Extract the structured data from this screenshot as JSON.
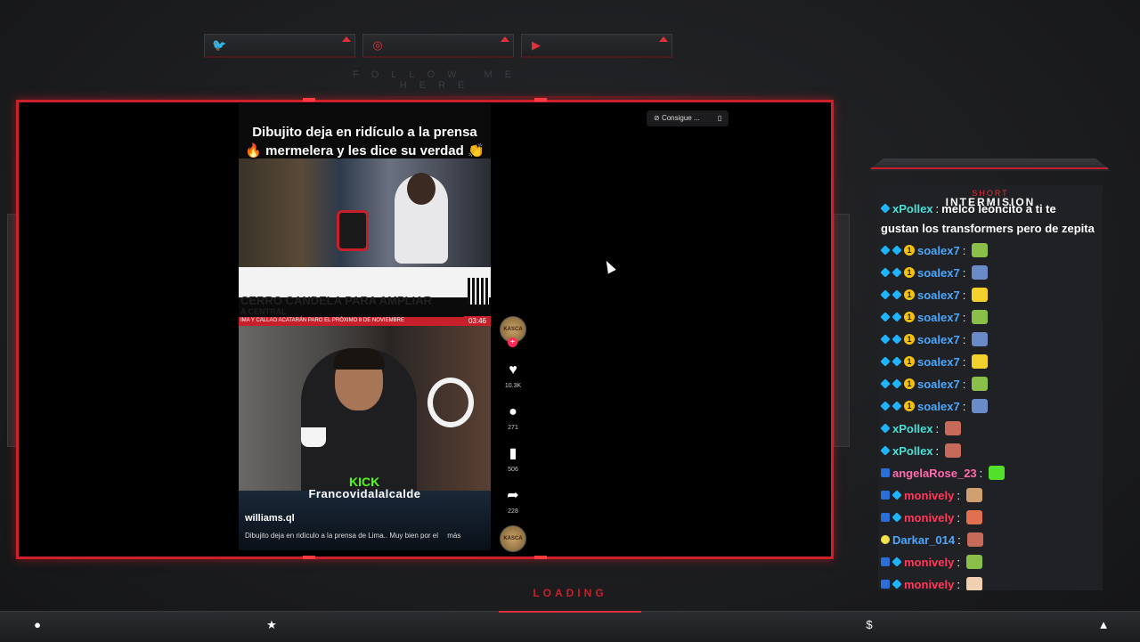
{
  "overlay": {
    "follow_text": "FOLLOW ME HERE",
    "loading_text": "LOADING",
    "chat_header_small": "SHORT",
    "chat_header_big": "INTERMISION"
  },
  "social": [
    {
      "icon": "twitter-icon",
      "glyph": "🐦"
    },
    {
      "icon": "instagram-icon",
      "glyph": "◎"
    },
    {
      "icon": "youtube-icon",
      "glyph": "▶"
    }
  ],
  "video": {
    "title_line1": "Dibujito deja en ridículo a la prensa",
    "title_line2": "🔥 mermelera y les dice su verdad 👏",
    "news_headline": "CERRO CANDELA PARA AMPLIAR",
    "news_sub": "A CENTRAL",
    "news_ticker": "IMA Y CALLAO ACATARÁN PARO EL PRÓXIMO 8 DE NOVIEMBRE",
    "news_time": "03:46",
    "kick_text": "KICK",
    "streamer_name": "Francovidalalcalde",
    "username": "williams.ql",
    "caption": "Dibujito deja en ridículo a la prensa de Lima.. Muy bien por el",
    "caption_more": "más",
    "avatar_text": "KASCA",
    "likes": "10.3K",
    "comments": "271",
    "saves": "506",
    "shares": "228"
  },
  "browser_popup": {
    "label": "Consigue ..."
  },
  "chat": {
    "first_line_user": "xPollex",
    "first_line_text": "melco leoncito a ti te",
    "first_line_text2": "gustan los transformers pero de zepita",
    "messages": [
      {
        "user": "soalex7",
        "color": "#4aa8ff",
        "badges": "cyan-cyan-gold",
        "emote": "#8ac04a"
      },
      {
        "user": "soalex7",
        "color": "#4aa8ff",
        "badges": "cyan-cyan-gold",
        "emote": "#6a8ac8"
      },
      {
        "user": "soalex7",
        "color": "#4aa8ff",
        "badges": "cyan-cyan-gold",
        "emote": "#f4d02a"
      },
      {
        "user": "soalex7",
        "color": "#4aa8ff",
        "badges": "cyan-cyan-gold",
        "emote": "#8ac04a"
      },
      {
        "user": "soalex7",
        "color": "#4aa8ff",
        "badges": "cyan-cyan-gold",
        "emote": "#6a8ac8"
      },
      {
        "user": "soalex7",
        "color": "#4aa8ff",
        "badges": "cyan-cyan-gold",
        "emote": "#f4d02a"
      },
      {
        "user": "soalex7",
        "color": "#4aa8ff",
        "badges": "cyan-cyan-gold",
        "emote": "#8ac04a"
      },
      {
        "user": "soalex7",
        "color": "#4aa8ff",
        "badges": "cyan-cyan-gold",
        "emote": "#6a8ac8"
      },
      {
        "user": "xPollex",
        "color": "#49e0d8",
        "badges": "cyan",
        "emote": "#c86a5a"
      },
      {
        "user": "xPollex",
        "color": "#49e0d8",
        "badges": "cyan",
        "emote": "#c86a5a"
      },
      {
        "user": "angelaRose_23",
        "color": "#ff6ab0",
        "badges": "blue",
        "emote": "#53e02a"
      },
      {
        "user": "monively",
        "color": "#ff3a5a",
        "badges": "blue-cyan",
        "emote": "#d0a070"
      },
      {
        "user": "monively",
        "color": "#ff3a5a",
        "badges": "blue-cyan",
        "emote": "#e07050"
      },
      {
        "user": "Darkar_014",
        "color": "#4aa8ff",
        "badges": "yel",
        "emote": "#c86a5a"
      },
      {
        "user": "monively",
        "color": "#ff3a5a",
        "badges": "blue-cyan",
        "emote": "#8ac04a"
      },
      {
        "user": "monively",
        "color": "#ff3a5a",
        "badges": "blue-cyan",
        "emote": "#f0d0b0"
      }
    ]
  },
  "bottom_icons": [
    {
      "name": "user-icon",
      "glyph": "●"
    },
    {
      "name": "star-icon",
      "glyph": "★"
    },
    {
      "name": "dollar-icon",
      "glyph": "$"
    },
    {
      "name": "rocket-icon",
      "glyph": "▲"
    }
  ]
}
